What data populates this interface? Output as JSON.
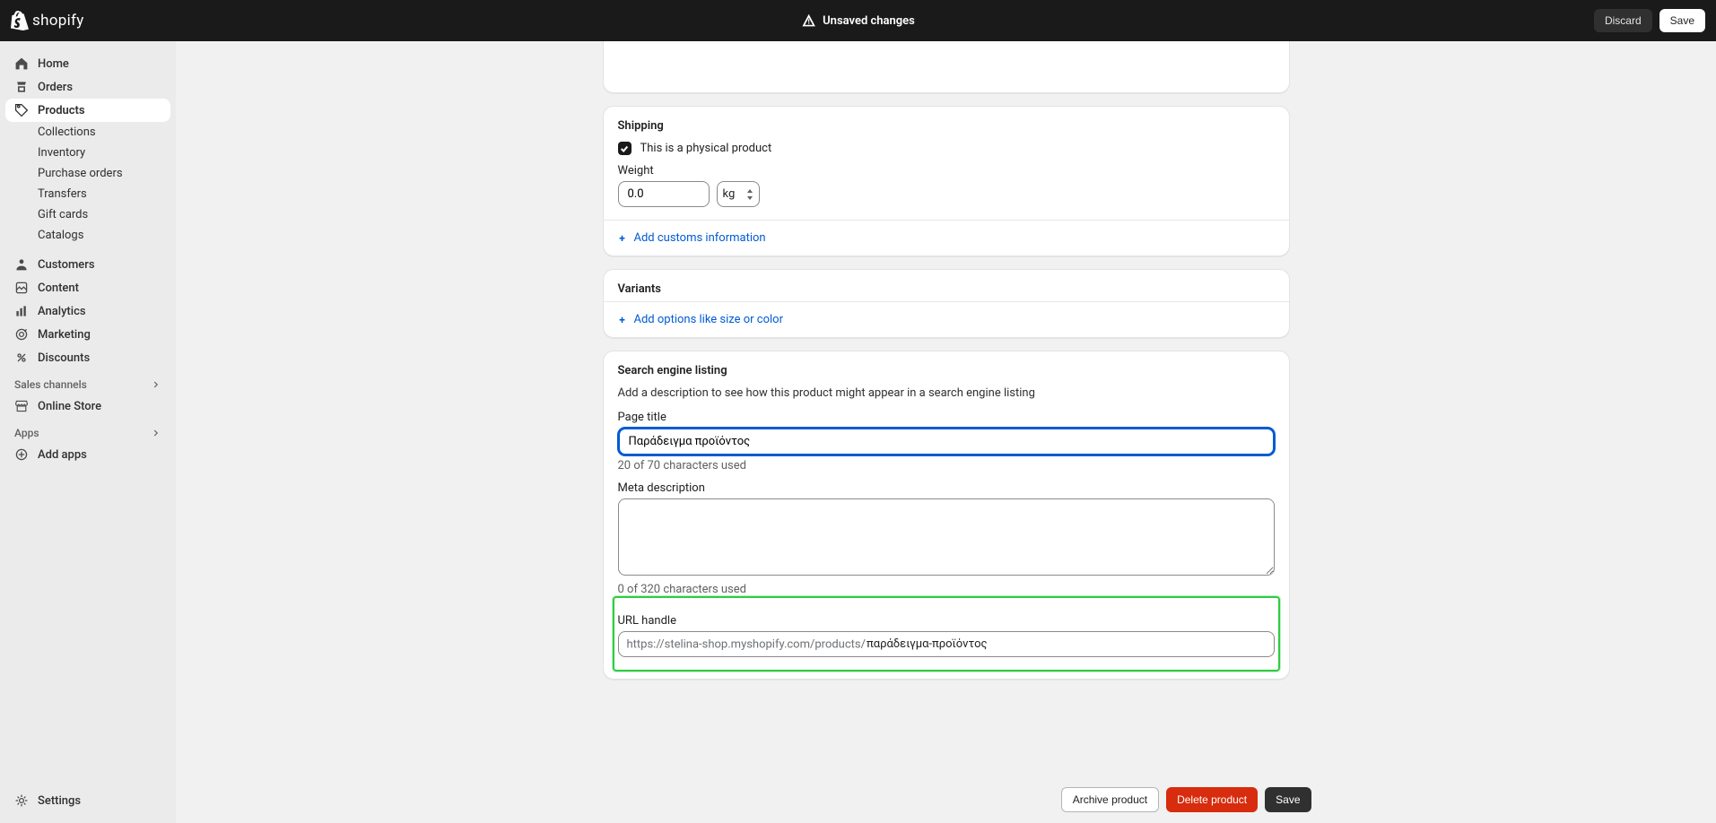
{
  "topbar": {
    "logo_text": "shopify",
    "unsaved_label": "Unsaved changes",
    "discard_label": "Discard",
    "save_label": "Save"
  },
  "sidebar": {
    "home": "Home",
    "orders": "Orders",
    "products": "Products",
    "products_sub": [
      "Collections",
      "Inventory",
      "Purchase orders",
      "Transfers",
      "Gift cards",
      "Catalogs"
    ],
    "customers": "Customers",
    "content": "Content",
    "analytics": "Analytics",
    "marketing": "Marketing",
    "discounts": "Discounts",
    "sales_channels_label": "Sales channels",
    "online_store": "Online Store",
    "apps_label": "Apps",
    "add_apps": "Add apps",
    "settings": "Settings"
  },
  "shipping": {
    "title": "Shipping",
    "physical_label": "This is a physical product",
    "weight_label": "Weight",
    "weight_value": "0.0",
    "unit_value": "kg",
    "add_customs_label": "Add customs information"
  },
  "variants": {
    "title": "Variants",
    "add_options_label": "Add options like size or color"
  },
  "seo": {
    "title": "Search engine listing",
    "description": "Add a description to see how this product might appear in a search engine listing",
    "page_title_label": "Page title",
    "page_title_value": "Παράδειγμα προϊόντος",
    "page_title_hint": "20 of 70 characters used",
    "meta_desc_label": "Meta description",
    "meta_desc_value": "",
    "meta_desc_hint": "0 of 320 characters used",
    "url_handle_label": "URL handle",
    "url_prefix": "https://stelina-shop.myshopify.com/products/",
    "url_handle_value": "παράδειγμα-προϊόντος"
  },
  "footer": {
    "archive_label": "Archive product",
    "delete_label": "Delete product",
    "save_label": "Save"
  }
}
